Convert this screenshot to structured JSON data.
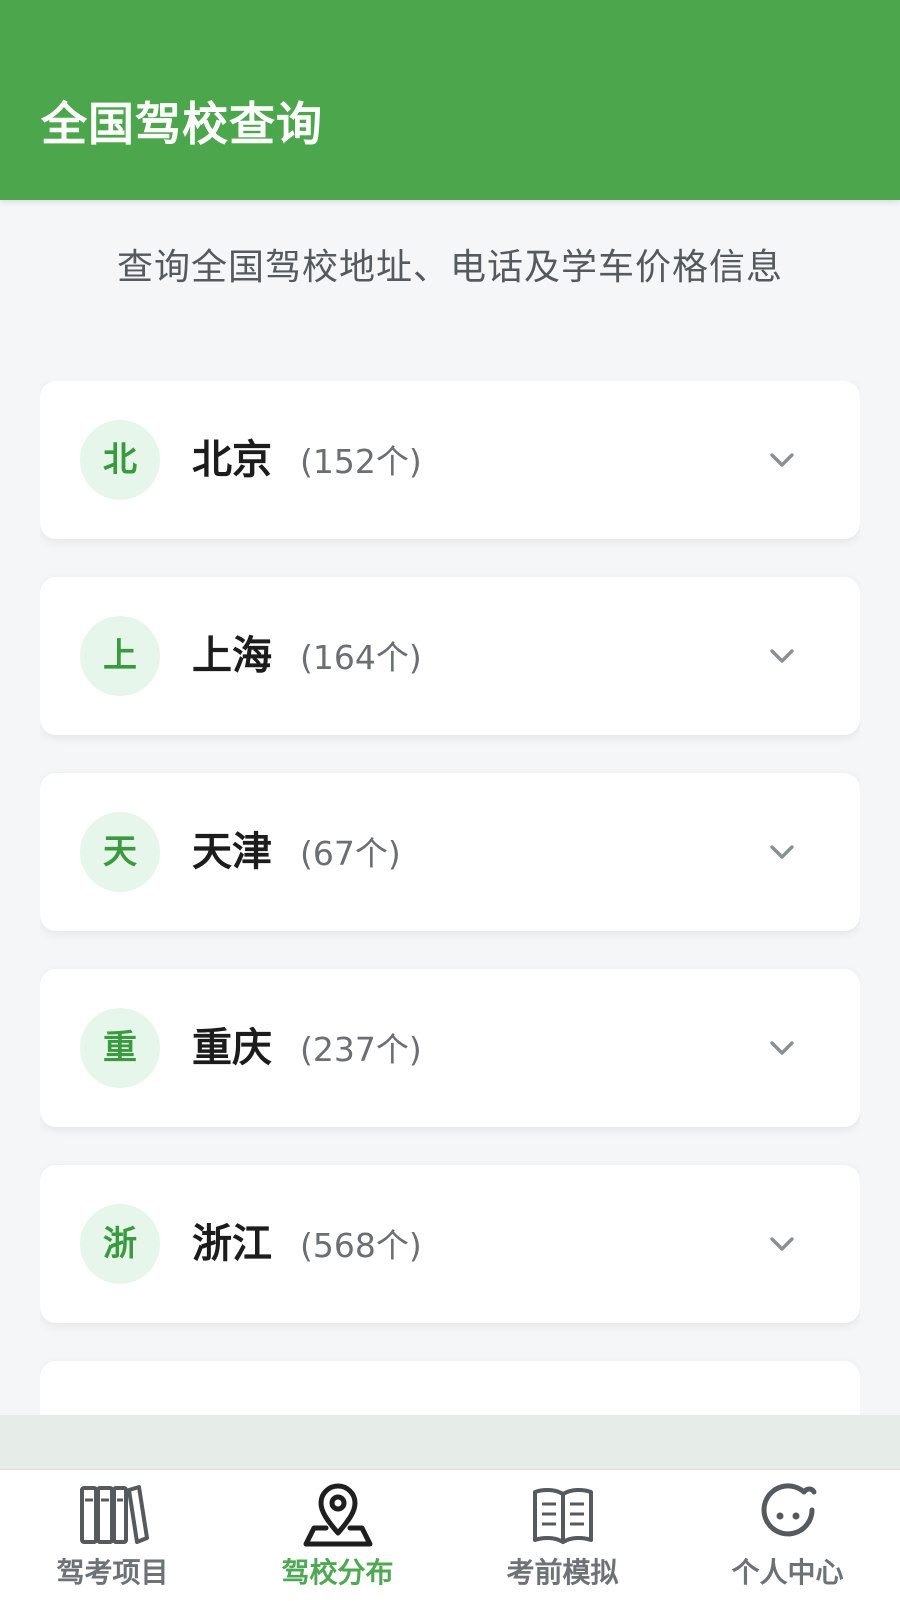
{
  "header": {
    "title": "全国驾校查询"
  },
  "subtitle": "查询全国驾校地址、电话及学车价格信息",
  "cities": [
    {
      "badge": "北",
      "name": "北京",
      "count": "(152个)"
    },
    {
      "badge": "上",
      "name": "上海",
      "count": "(164个)"
    },
    {
      "badge": "天",
      "name": "天津",
      "count": "(67个)"
    },
    {
      "badge": "重",
      "name": "重庆",
      "count": "(237个)"
    },
    {
      "badge": "浙",
      "name": "浙江",
      "count": "(568个)"
    }
  ],
  "tabs": [
    {
      "label": "驾考项目",
      "icon": "books-icon",
      "active": false
    },
    {
      "label": "驾校分布",
      "icon": "map-pin-icon",
      "active": true
    },
    {
      "label": "考前模拟",
      "icon": "open-book-icon",
      "active": false
    },
    {
      "label": "个人中心",
      "icon": "face-icon",
      "active": false
    }
  ],
  "colors": {
    "brand_green": "#4ca64c",
    "badge_bg": "#e7f6ea",
    "badge_text": "#3a9a3e",
    "active_tab": "#4fa853",
    "inactive_tab": "#6d7277",
    "page_bg": "#f4f6f8"
  }
}
